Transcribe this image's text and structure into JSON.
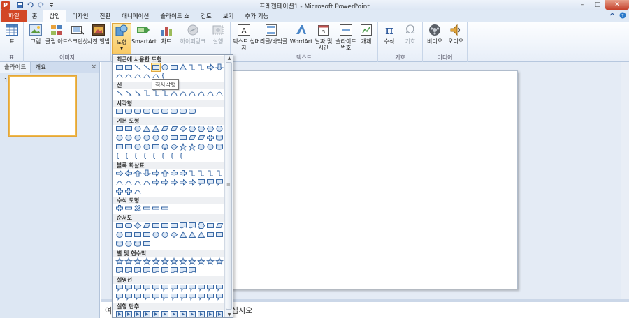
{
  "window": {
    "title": "프레젠테이션1  -  Microsoft PowerPoint",
    "app_icon_letter": "P",
    "qat_icons": [
      "save-icon",
      "undo-icon",
      "redo-icon",
      "customize-qat-icon"
    ],
    "controls": {
      "minimize": "–",
      "maximize": "□",
      "close": "✕"
    }
  },
  "tabs": [
    {
      "label": "파일",
      "kind": "file"
    },
    {
      "label": "홈",
      "kind": "normal"
    },
    {
      "label": "삽입",
      "kind": "active"
    },
    {
      "label": "디자인",
      "kind": "normal"
    },
    {
      "label": "전환",
      "kind": "normal"
    },
    {
      "label": "애니메이션",
      "kind": "normal"
    },
    {
      "label": "슬라이드 쇼",
      "kind": "normal"
    },
    {
      "label": "검토",
      "kind": "normal"
    },
    {
      "label": "보기",
      "kind": "normal"
    },
    {
      "label": "추가 기능",
      "kind": "normal"
    }
  ],
  "ribbon": {
    "groups": [
      {
        "name": "표",
        "buttons": [
          {
            "label": "표",
            "icon": "table-icon"
          }
        ]
      },
      {
        "name": "이미지",
        "buttons": [
          {
            "label": "그림",
            "icon": "picture-icon"
          },
          {
            "label": "클립 아트",
            "icon": "clipart-icon"
          },
          {
            "label": "스크린샷",
            "icon": "screenshot-icon"
          },
          {
            "label": "사진 앨범",
            "icon": "photo-album-icon"
          }
        ]
      },
      {
        "name": "",
        "buttons": [
          {
            "label": "도형",
            "icon": "shapes-icon"
          },
          {
            "label": "SmartArt",
            "icon": "smartart-icon"
          },
          {
            "label": "차트",
            "icon": "chart-icon"
          }
        ]
      },
      {
        "name": "",
        "buttons": [
          {
            "label": "하이퍼링크",
            "icon": "hyperlink-icon"
          },
          {
            "label": "실행",
            "icon": "action-icon"
          }
        ]
      },
      {
        "name": "텍스트",
        "buttons": [
          {
            "label": "텍스트 상자",
            "icon": "textbox-icon"
          },
          {
            "label": "머리글/바닥글",
            "icon": "header-footer-icon"
          },
          {
            "label": "WordArt",
            "icon": "wordart-icon"
          },
          {
            "label": "날짜 및 시간",
            "icon": "date-time-icon"
          },
          {
            "label": "슬라이드 번호",
            "icon": "slide-number-icon"
          },
          {
            "label": "개체",
            "icon": "object-icon"
          }
        ]
      },
      {
        "name": "기호",
        "buttons": [
          {
            "label": "수식",
            "icon": "equation-icon"
          },
          {
            "label": "기호",
            "icon": "symbol-icon"
          }
        ]
      },
      {
        "name": "미디어",
        "buttons": [
          {
            "label": "비디오",
            "icon": "video-icon"
          },
          {
            "label": "오디오",
            "icon": "audio-icon"
          }
        ]
      }
    ]
  },
  "left_panel": {
    "tabs": [
      "슬라이드",
      "개요"
    ],
    "close": "×",
    "slide_number": "1"
  },
  "notes": {
    "text_start": "여",
    "text_end": "십시오"
  },
  "shapes_gallery": {
    "tooltip": "직사각형",
    "categories": [
      {
        "label": "최근에 사용한 도형"
      },
      {
        "label": "선"
      },
      {
        "label": "사각형"
      },
      {
        "label": "기본 도형"
      },
      {
        "label": "블록 화살표"
      },
      {
        "label": "수식 도형"
      },
      {
        "label": "순서도"
      },
      {
        "label": "별 및 현수막"
      },
      {
        "label": "설명선"
      },
      {
        "label": "실행 단추"
      }
    ]
  },
  "colors": {
    "file_tab": "#d24726",
    "pressed_button": "#f8c760",
    "selected_slide_border": "#f0b94a"
  }
}
